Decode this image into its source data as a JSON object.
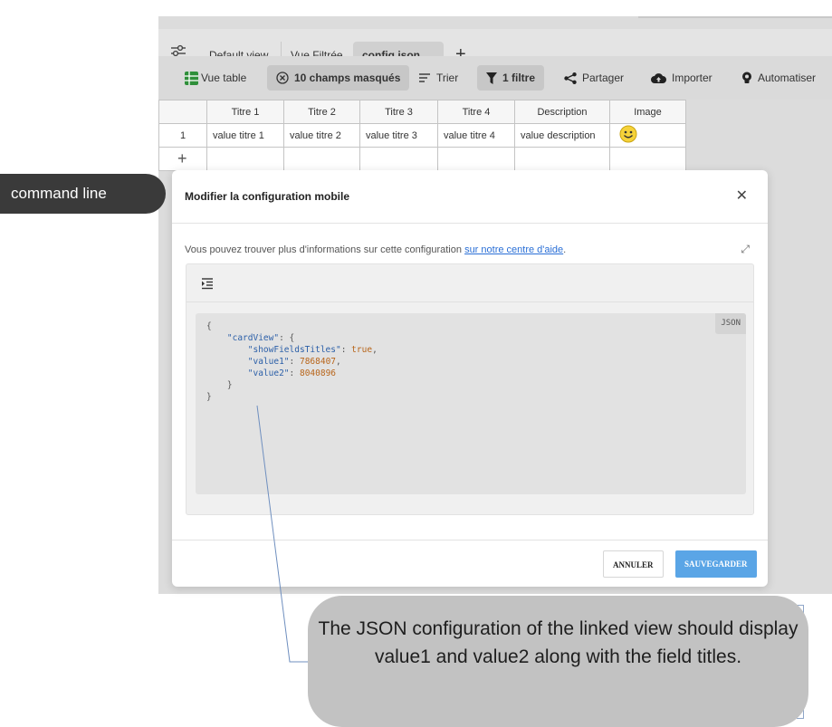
{
  "tabs": [
    {
      "label": "Default view"
    },
    {
      "label": "Vue Filtrée"
    },
    {
      "label": "config json",
      "active": true
    }
  ],
  "toolbar": {
    "table_view": "Vue table",
    "hidden_fields": "10 champs masqués",
    "sort": "Trier",
    "filter": "1 filtre",
    "share": "Partager",
    "import": "Importer",
    "automate": "Automatiser"
  },
  "grid": {
    "columns": [
      "Titre 1",
      "Titre 2",
      "Titre 3",
      "Titre 4",
      "Description",
      "Image"
    ],
    "rows": [
      {
        "index": "1",
        "cells": [
          "value titre 1",
          "value titre 2",
          "value titre 3",
          "value titre 4",
          "value description"
        ],
        "image_icon": "smiley-icon"
      }
    ],
    "add_row": "+"
  },
  "modal": {
    "title": "Modifier la configuration mobile",
    "info_text": "Vous pouvez trouver plus d'informations sur cette configuration ",
    "info_link": "sur notre centre d'aide",
    "info_end": ".",
    "code_lang": "JSON",
    "json": {
      "root_key": "\"cardView\"",
      "k1": "\"showFieldsTitles\"",
      "v1": "true",
      "k2": "\"value1\"",
      "v2": "7868407",
      "k3": "\"value2\"",
      "v3": "8040896"
    },
    "cancel_label": "ANNULER",
    "save_label": "SAUVEGARDER"
  },
  "command_label": "command line",
  "callout": {
    "text": "The JSON configuration of the linked view should display value1 and value2 along with the field titles."
  },
  "colors": {
    "save_button": "#5aa5e6",
    "json_key": "#2b5fa8",
    "json_value": "#b8651a",
    "callout_bg": "#c2c2c2"
  }
}
